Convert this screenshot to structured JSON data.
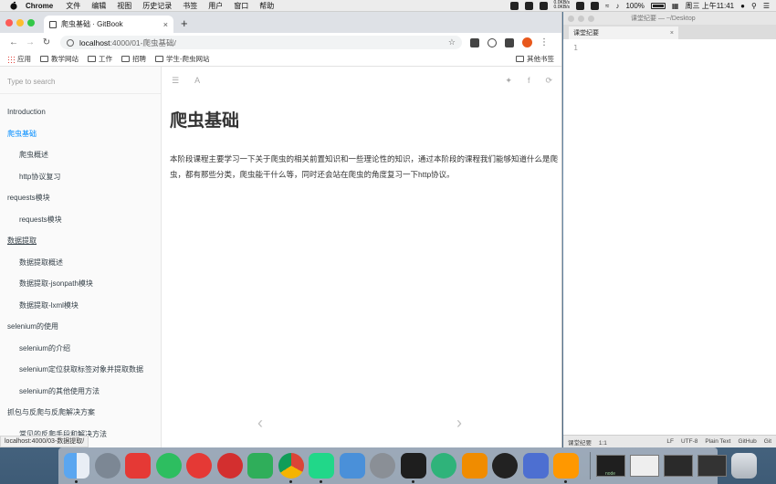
{
  "menubar": {
    "app_name": "Chrome",
    "menus": [
      "文件",
      "编辑",
      "视图",
      "历史记录",
      "书签",
      "用户",
      "窗口",
      "帮助"
    ],
    "net_up": "0.0KB/s",
    "net_down": "0.0KB/s",
    "battery": "100%",
    "datetime": "周三 上午11:41"
  },
  "browser": {
    "tab_title": "爬虫基础 · GitBook",
    "tab_close": "×",
    "new_tab": "+",
    "url_host": "localhost",
    "url_path": ":4000/01-爬虫基础/",
    "bookmarks": [
      "应用",
      "教学网站",
      "工作",
      "招聘",
      "学生-爬虫网站"
    ],
    "other_bookmarks": "其他书签",
    "status_url": "localhost:4000/03-数据提取/"
  },
  "gitbook": {
    "search_placeholder": "Type to search",
    "toc": [
      {
        "label": "Introduction",
        "level": 1,
        "state": "normal"
      },
      {
        "label": "爬虫基础",
        "level": 1,
        "state": "active"
      },
      {
        "label": "爬虫概述",
        "level": 2,
        "state": "normal"
      },
      {
        "label": "http协议复习",
        "level": 2,
        "state": "normal"
      },
      {
        "label": "requests模块",
        "level": 1,
        "state": "normal"
      },
      {
        "label": "requests模块",
        "level": 2,
        "state": "normal"
      },
      {
        "label": "数据提取",
        "level": 1,
        "state": "hover"
      },
      {
        "label": "数据提取概述",
        "level": 2,
        "state": "normal"
      },
      {
        "label": "数据提取-jsonpath模块",
        "level": 2,
        "state": "normal"
      },
      {
        "label": "数据提取-lxml模块",
        "level": 2,
        "state": "normal"
      },
      {
        "label": "selenium的使用",
        "level": 1,
        "state": "normal"
      },
      {
        "label": "selenium的介绍",
        "level": 2,
        "state": "normal"
      },
      {
        "label": "selenium定位获取标签对象并提取数据",
        "level": 2,
        "state": "normal"
      },
      {
        "label": "selenium的其他使用方法",
        "level": 2,
        "state": "normal"
      },
      {
        "label": "抓包与反爬与反爬解决方案",
        "level": 1,
        "state": "normal"
      },
      {
        "label": "常见的反爬手段和解决方法",
        "level": 2,
        "state": "normal"
      }
    ],
    "header_font_icon": "A",
    "page_title": "爬虫基础",
    "page_body": "本阶段课程主要学习一下关于爬虫的相关前置知识和一些理论性的知识，通过本阶段的课程我们能够知道什么是爬虫，都有那些分类，爬虫能干什么等，同时还会站在爬虫的角度复习一下http协议。",
    "prev_arrow": "‹",
    "next_arrow": "›"
  },
  "sublime": {
    "window_title": "课堂纪要 — ~/Desktop",
    "tab_label": "课堂纪要",
    "tab_close": "×",
    "line_number": "1",
    "status_left": [
      "课堂纪要",
      "1:1"
    ],
    "status_right": [
      "LF",
      "UTF-8",
      "Plain Text",
      "GitHub",
      "Git"
    ]
  },
  "dock": {
    "terminal_thumb_label": "node"
  },
  "colors": {
    "link_active": "#008cff",
    "sidebar_bg": "#fafafa",
    "chrome_frame": "#dee1e6"
  }
}
